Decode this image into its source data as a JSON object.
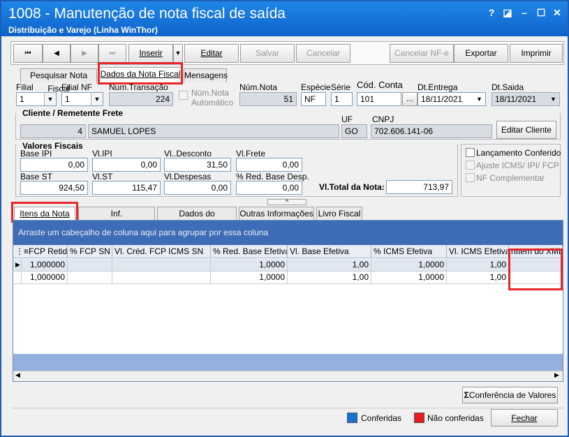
{
  "window": {
    "title": "1008 - Manutenção de nota fiscal de saída",
    "subtitle": "Distribuição e Varejo (Linha WinThor)",
    "controls": [
      "?",
      "◪",
      "–",
      "☐",
      "✕"
    ]
  },
  "toolbar": {
    "first": "⏮",
    "prev": "◀",
    "next": "▶",
    "last": "⏭",
    "insert": "Inserir",
    "insert_menu": "▼",
    "edit": "Editar",
    "save": "Salvar",
    "cancel": "Cancelar",
    "cancel_nfe": "Cancelar NF-e",
    "export": "Exportar",
    "print": "Imprimir"
  },
  "main_tabs": [
    "Pesquisar Nota Fiscal",
    "Dados da Nota Fiscal",
    "Mensagens"
  ],
  "header": {
    "filial_label": "Filial",
    "filial_value": "1",
    "filial_nf_label": "Filial NF",
    "filial_nf_value": "1",
    "num_transacao_label": "Num.Transação",
    "num_transacao_value": "224",
    "num_nota_auto_label": "Núm.Nota Automático",
    "num_nota_label": "Núm.Nota",
    "num_nota_value": "51",
    "especie_label": "Espécie",
    "especie_value": "NF",
    "serie_label": "Série",
    "serie_value": "1",
    "cod_conta_label": "Cód. Conta",
    "cod_conta_value": "101",
    "cod_conta_btn": "...",
    "dt_entrega_label": "Dt.Entrega",
    "dt_entrega_value": "18/11/2021",
    "dt_saida_label": "Dt.Saida",
    "dt_saida_value": "18/11/2021"
  },
  "cliente": {
    "section_label": "Cliente / Remetente Frete",
    "code": "4",
    "name": "SAMUEL LOPES",
    "uf_label": "UF",
    "uf_value": "GO",
    "cnpj_label": "CNPJ",
    "cnpj_value": "702.606.141-06",
    "edit_button": "Editar Cliente"
  },
  "valores": {
    "section_label": "Valores Fiscais",
    "base_ipi_label": "Base IPI",
    "base_ipi": "0,00",
    "vl_ipi_label": "Vl.IPI",
    "vl_ipi": "0,00",
    "vl_desconto_label": "Vl..Desconto",
    "vl_desconto": "31,50",
    "vl_frete_label": "Vl.Frete",
    "vl_frete": "0,00",
    "base_st_label": "Base ST",
    "base_st": "924,50",
    "vl_st_label": "Vl.ST",
    "vl_st": "115,47",
    "vl_despesas_label": "Vl.Despesas",
    "vl_despesas": "0,00",
    "red_base_label": "% Red. Base Desp.",
    "red_base": "0,00",
    "total_label": "Vl.Total da Nota:",
    "total": "713,97"
  },
  "options": {
    "lanc_conferido": "Lançamento Conferido",
    "ajuste_icms": "Ajuste ICMS/ IPI/ FCP",
    "nf_complementar": "NF Complementar"
  },
  "item_tabs": [
    "Itens da Nota",
    "Inf. Complementares",
    "Dados do Transporte",
    "Outras Informações",
    "Livro Fiscal"
  ],
  "grid": {
    "group_hint": "Arraste um cabeçalho de coluna aqui para agrupar por essa coluna",
    "columns": [
      "FCP Retido",
      "% FCP SN",
      "Vl. Créd. FCP ICMS SN",
      "% Red. Base Efetiva",
      "Vl. Base Efetiva",
      "% ICMS Efetiva",
      "Vl. ICMS Efetiva",
      "nItem do XML"
    ],
    "rows": [
      [
        "1,000000",
        "",
        "",
        "1,0000",
        "1,00",
        "1,0000",
        "1,00",
        ""
      ],
      [
        "1,000000",
        "",
        "",
        "1,0000",
        "1,00",
        "1,0000",
        "1,00",
        ""
      ]
    ]
  },
  "footer": {
    "conferencia_button": "Conferência de Valores",
    "legend_conferidas": "Conferidas",
    "legend_nao_conferidas": "Não conferidas",
    "close_button": "Fechar",
    "colors": {
      "conferidas": "#1673d6",
      "nao_conferidas": "#e81c1c"
    }
  }
}
